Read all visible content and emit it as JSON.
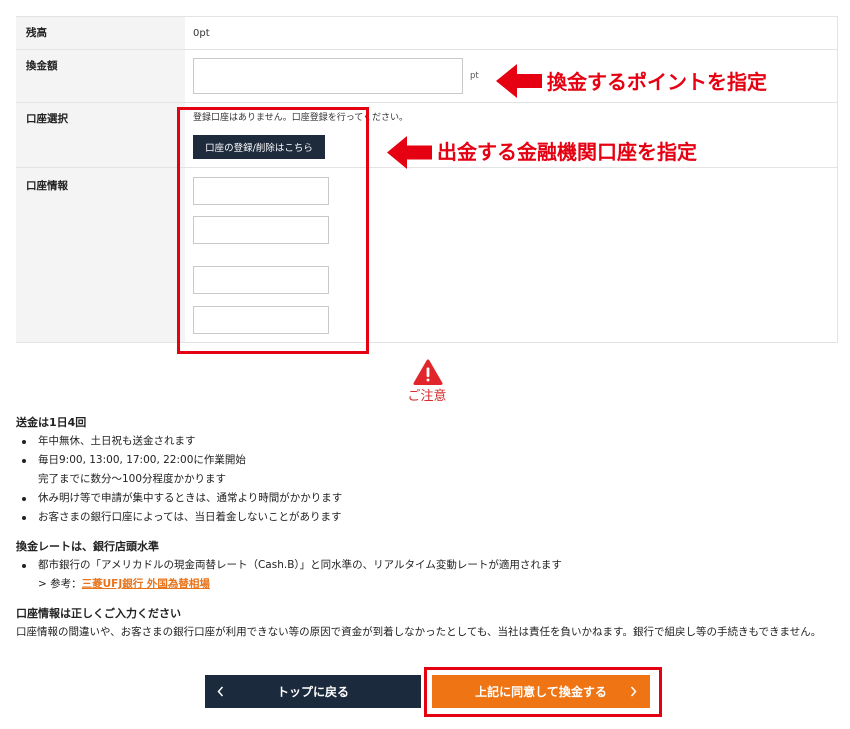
{
  "balance": {
    "label": "残高",
    "value": "0pt"
  },
  "amount": {
    "label": "換金額",
    "value": "",
    "unit": "pt"
  },
  "account_select": {
    "label": "口座選択",
    "message": "登録口座はありません。口座登録を行ってください。",
    "button_label": "口座の登録/削除はこちら"
  },
  "account_info": {
    "label": "口座情報",
    "fields": [
      {
        "value": ""
      },
      {
        "value": ""
      },
      {
        "value": ""
      },
      {
        "value": ""
      }
    ]
  },
  "annotations": {
    "amount_hint": "換金するポイントを指定",
    "account_hint": "出金する金融機関口座を指定"
  },
  "notice": {
    "icon": "warning-icon",
    "title": "ご注意",
    "transfer": {
      "heading": "送金は1日4回",
      "items": [
        {
          "text": "年中無休、土日祝も送金されます"
        },
        {
          "text": "毎日9:00, 13:00, 17:00, 22:00に作業開始",
          "sub": "完了までに数分〜100分程度かかります"
        },
        {
          "text": "休み明け等で申請が集中するときは、通常より時間がかかります"
        },
        {
          "text": "お客さまの銀行口座によっては、当日着金しないことがあります"
        }
      ]
    },
    "rate": {
      "heading": "換金レートは、銀行店頭水準",
      "items": [
        {
          "text": "都市銀行の「アメリカドルの現金両替レート（Cash.B）」と同水準の、リアルタイム変動レートが適用されます",
          "reference_prefix": "> 参考：",
          "reference_link": "三菱UFJ銀行 外国為替相場"
        }
      ]
    },
    "account": {
      "heading": "口座情報は正しくご入力ください",
      "body": "口座情報の間違いや、お客さまの銀行口座が利用できない等の原因で資金が到着しなかったとしても、当社は責任を負いかねます。銀行で組戻し等の手続きもできません。"
    }
  },
  "actions": {
    "back_label": "トップに戻る",
    "back_icon": "chevron-left-icon",
    "submit_label": "上記に同意して換金する",
    "submit_icon": "chevron-right-icon"
  },
  "colors": {
    "annotation_red": "#e50012",
    "primary_button": "#ef7414",
    "secondary_button": "#1b2a3c",
    "link": "#e8731a",
    "warning": "#e0262b"
  }
}
